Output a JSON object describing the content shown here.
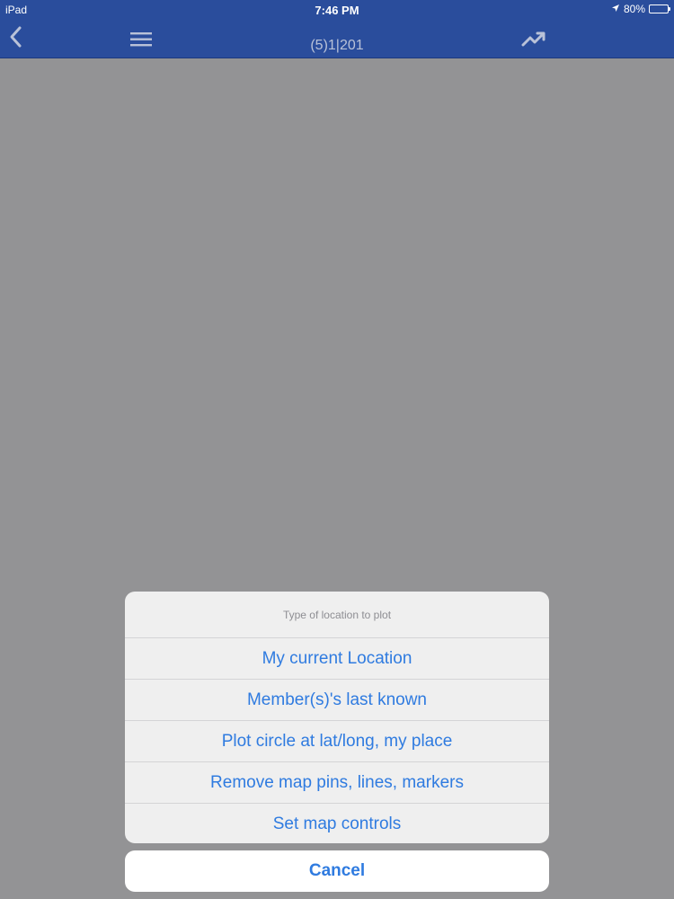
{
  "status_bar": {
    "carrier": "iPad",
    "time": "7:46 PM",
    "battery": "80%",
    "battery_level": 0.8,
    "location_icon": "location-arrow-icon"
  },
  "nav_bar": {
    "title": "(5)1|201",
    "back_icon": "chevron-left-icon",
    "menu_icon": "hamburger-menu-icon",
    "trend_icon": "trending-up-icon"
  },
  "action_sheet": {
    "header": "Type of location to plot",
    "actions": [
      "My current Location",
      "Member(s)'s last known",
      "Plot circle at lat/long, my place",
      "Remove map pins, lines, markers",
      "Set map controls"
    ],
    "cancel_label": "Cancel"
  },
  "colors": {
    "nav_background": "#2a4d9c",
    "dimmed_background": "#939395",
    "action_text": "#2f7be0"
  }
}
